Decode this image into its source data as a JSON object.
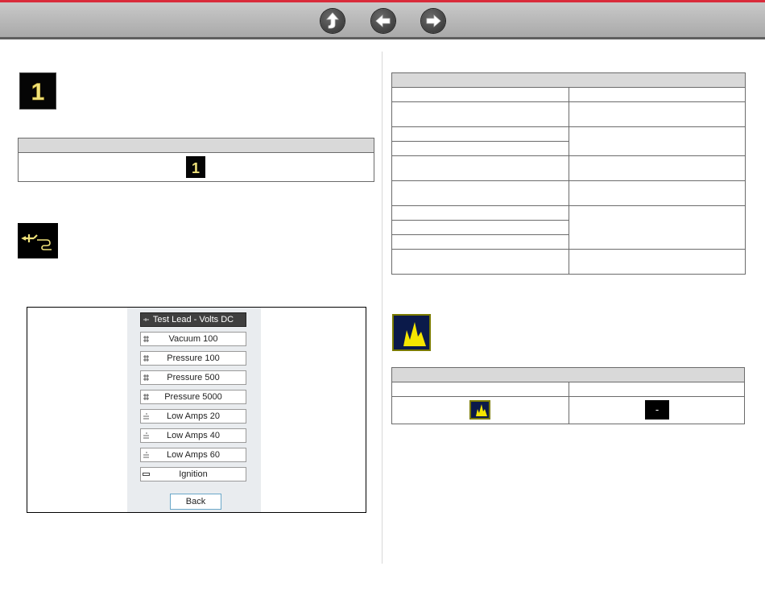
{
  "toolbar": {
    "home_icon": "home-up-arrow-icon",
    "back_icon": "left-arrow-icon",
    "forward_icon": "right-arrow-icon"
  },
  "left": {
    "digit_icon_label": "1",
    "table_cell_icon_label": "1",
    "menu": {
      "items": [
        {
          "label": "Test Lead - Volts DC",
          "selected": true
        },
        {
          "label": "Vacuum 100",
          "selected": false
        },
        {
          "label": "Pressure 100",
          "selected": false
        },
        {
          "label": "Pressure 500",
          "selected": false
        },
        {
          "label": "Pressure 5000",
          "selected": false
        },
        {
          "label": "Low Amps 20",
          "selected": false
        },
        {
          "label": "Low Amps 40",
          "selected": false
        },
        {
          "label": "Low Amps 60",
          "selected": false
        },
        {
          "label": "Ignition",
          "selected": false
        }
      ],
      "back_label": "Back"
    }
  },
  "right": {
    "bottom_table_minus_label": "-"
  }
}
